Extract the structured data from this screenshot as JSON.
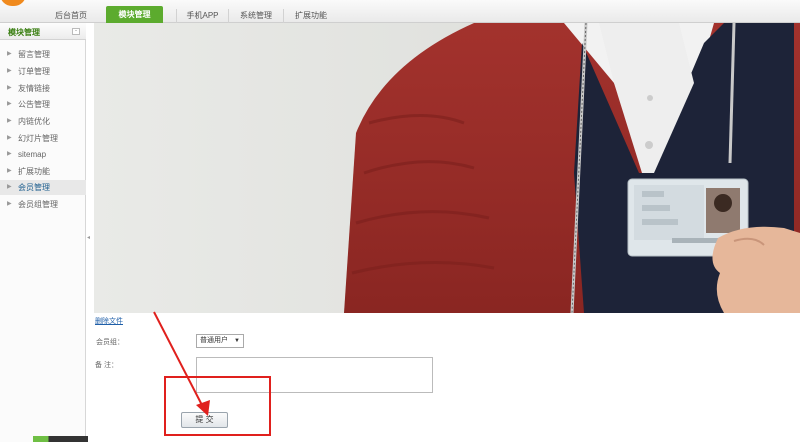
{
  "topnav": {
    "tabs": [
      {
        "label": "后台首页"
      },
      {
        "label": "模块管理",
        "active": true
      },
      {
        "label": "手机APP"
      },
      {
        "label": "系统管理"
      },
      {
        "label": "扩展功能"
      }
    ]
  },
  "sidebar": {
    "title": "模块管理",
    "collapse_glyph": "-",
    "items": [
      {
        "label": "留言管理"
      },
      {
        "label": "订单管理"
      },
      {
        "label": "友情链接"
      },
      {
        "label": "公告管理"
      },
      {
        "label": "内链优化"
      },
      {
        "label": "幻灯片管理"
      },
      {
        "label": "sitemap"
      },
      {
        "label": "扩展功能"
      },
      {
        "label": "会员管理",
        "active": true
      },
      {
        "label": "会员组管理"
      }
    ]
  },
  "form": {
    "delete_link": "删除文件",
    "group_label": "会员组：",
    "group_value": "普通用户",
    "remark_label": "备 注：",
    "submit_label": "提 交"
  },
  "colors": {
    "accent_green": "#5cab2e",
    "annotation_red": "#e0201d",
    "link_blue": "#1f5fa8"
  },
  "icons": {
    "arrow": "right-triangle",
    "caret": "down-triangle"
  }
}
